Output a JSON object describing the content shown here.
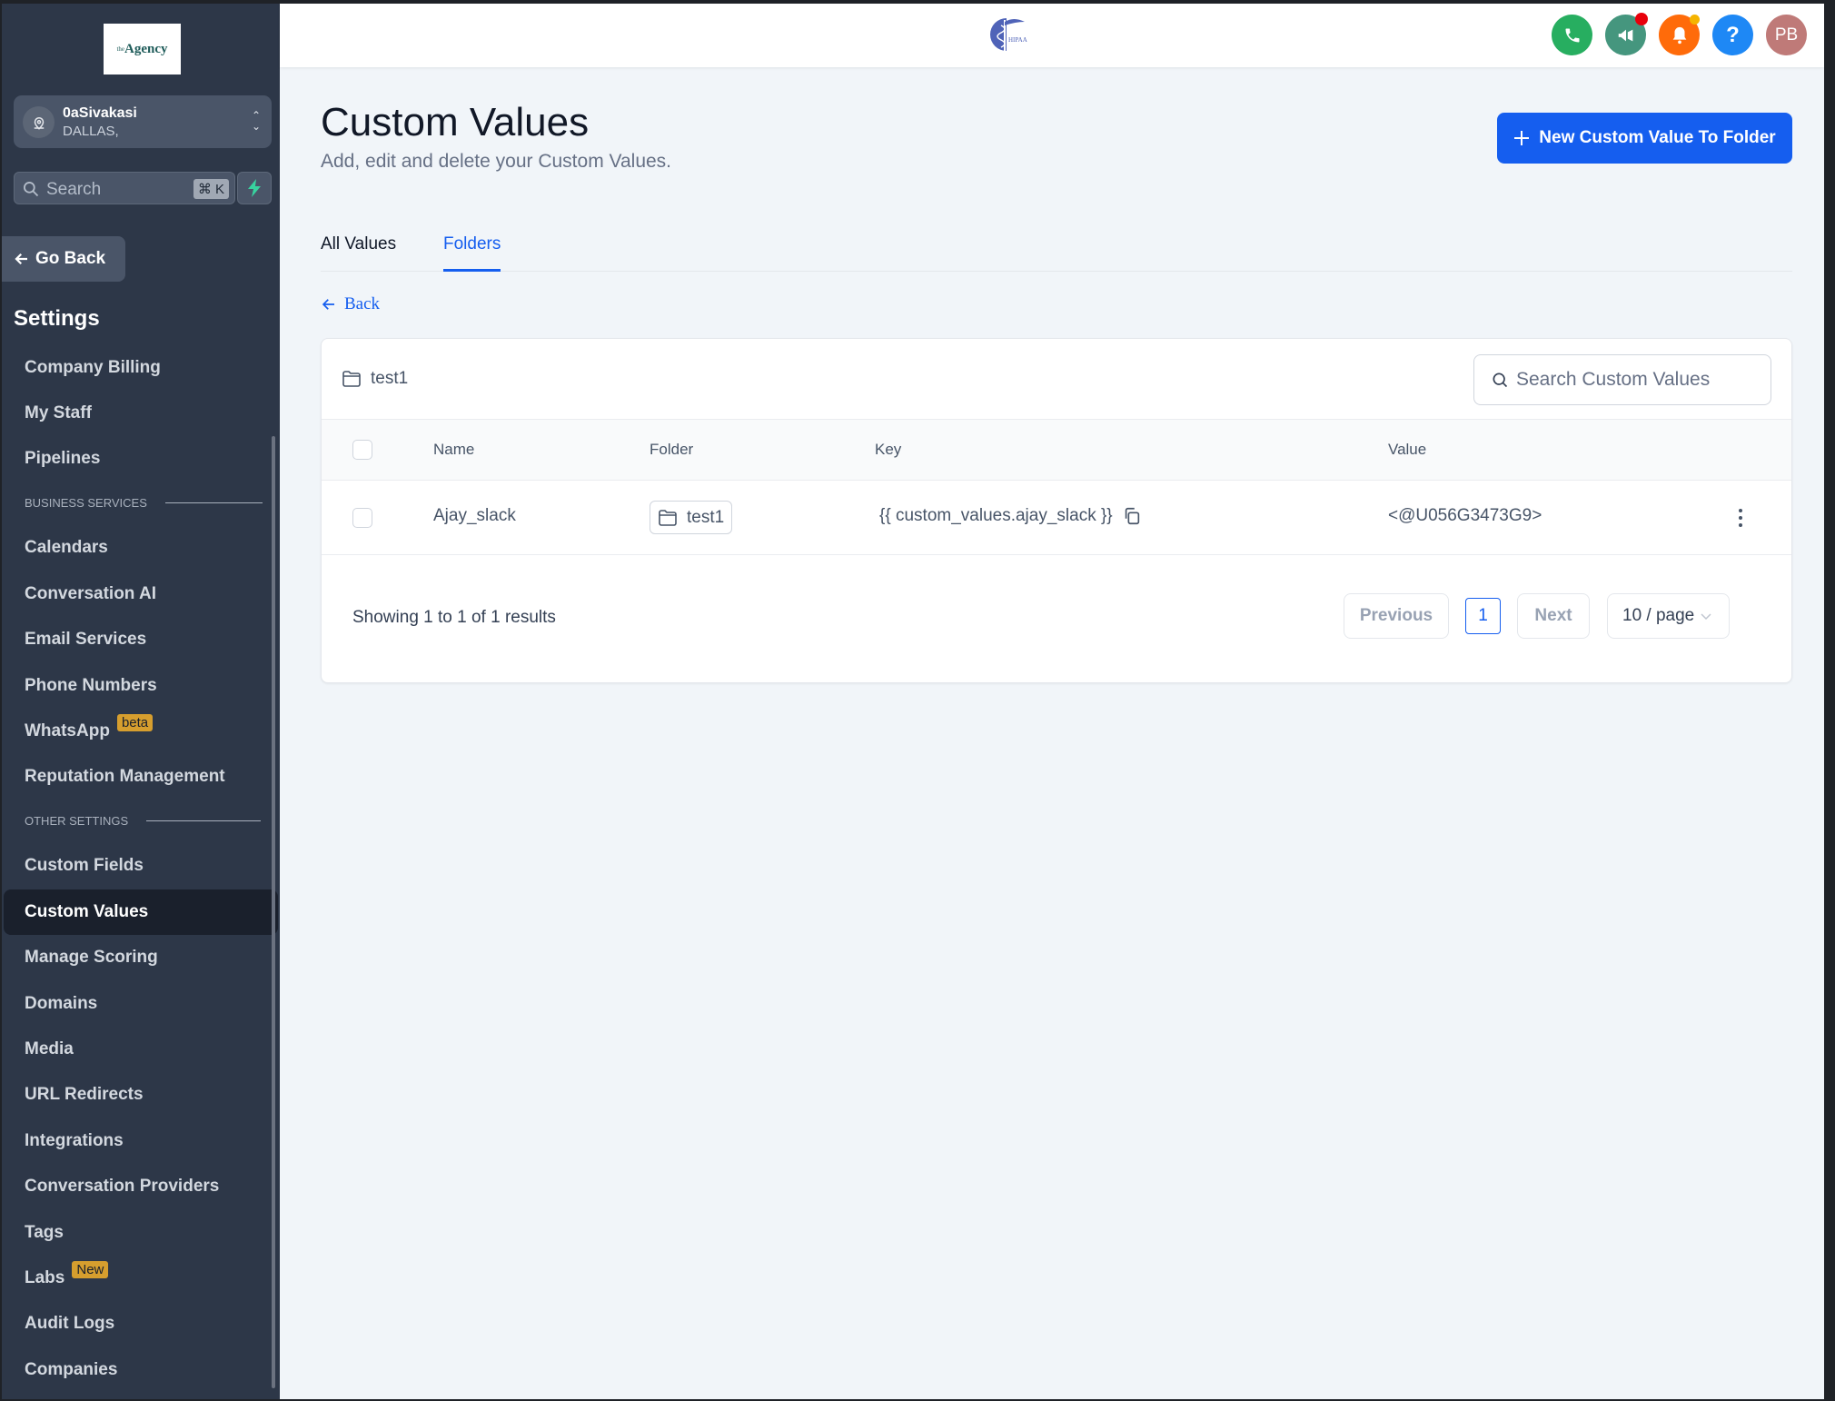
{
  "sidebar": {
    "logo_text": "Agency",
    "logo_prefix": "the",
    "location": {
      "name": "0aSivakasi",
      "city": "DALLAS,"
    },
    "search": {
      "placeholder": "Search",
      "shortcut": "⌘ K"
    },
    "go_back": "Go Back",
    "heading": "Settings",
    "items_top": [
      "Company Billing",
      "My Staff",
      "Pipelines"
    ],
    "section_business": "BUSINESS SERVICES",
    "items_business": [
      "Calendars",
      "Conversation AI",
      "Email Services",
      "Phone Numbers",
      "WhatsApp",
      "Reputation Management"
    ],
    "whatsapp_badge": "beta",
    "section_other": "OTHER SETTINGS",
    "items_other": [
      "Custom Fields",
      "Custom Values",
      "Manage Scoring",
      "Domains",
      "Media",
      "URL Redirects",
      "Integrations",
      "Conversation Providers",
      "Tags",
      "Labs",
      "Audit Logs",
      "Companies"
    ],
    "labs_badge": "New",
    "active_item": "Custom Values"
  },
  "header": {
    "center_logo_text": "HIPAA",
    "avatar_initials": "PB",
    "colors": {
      "phone": "#27ae60",
      "megaphone": "#45967e",
      "bell": "#ff6b0a",
      "help": "#1e88f5",
      "avatar": "#bf7a78"
    }
  },
  "page": {
    "title": "Custom Values",
    "subtitle": "Add, edit and delete your Custom Values.",
    "new_button": "New Custom Value To Folder",
    "tabs": [
      {
        "label": "All Values",
        "active": false
      },
      {
        "label": "Folders",
        "active": true
      }
    ],
    "back_link": "Back"
  },
  "card": {
    "folder_name": "test1",
    "search_placeholder": "Search Custom Values",
    "columns": [
      "Name",
      "Folder",
      "Key",
      "Value"
    ],
    "rows": [
      {
        "name": "Ajay_slack",
        "folder": "test1",
        "key": "{{ custom_values.ajay_slack }}",
        "value": "<@U056G3473G9>"
      }
    ],
    "showing": "Showing 1 to 1 of 1 results",
    "pagination": {
      "previous": "Previous",
      "current_page": "1",
      "next": "Next",
      "page_size": "10 / page"
    }
  }
}
